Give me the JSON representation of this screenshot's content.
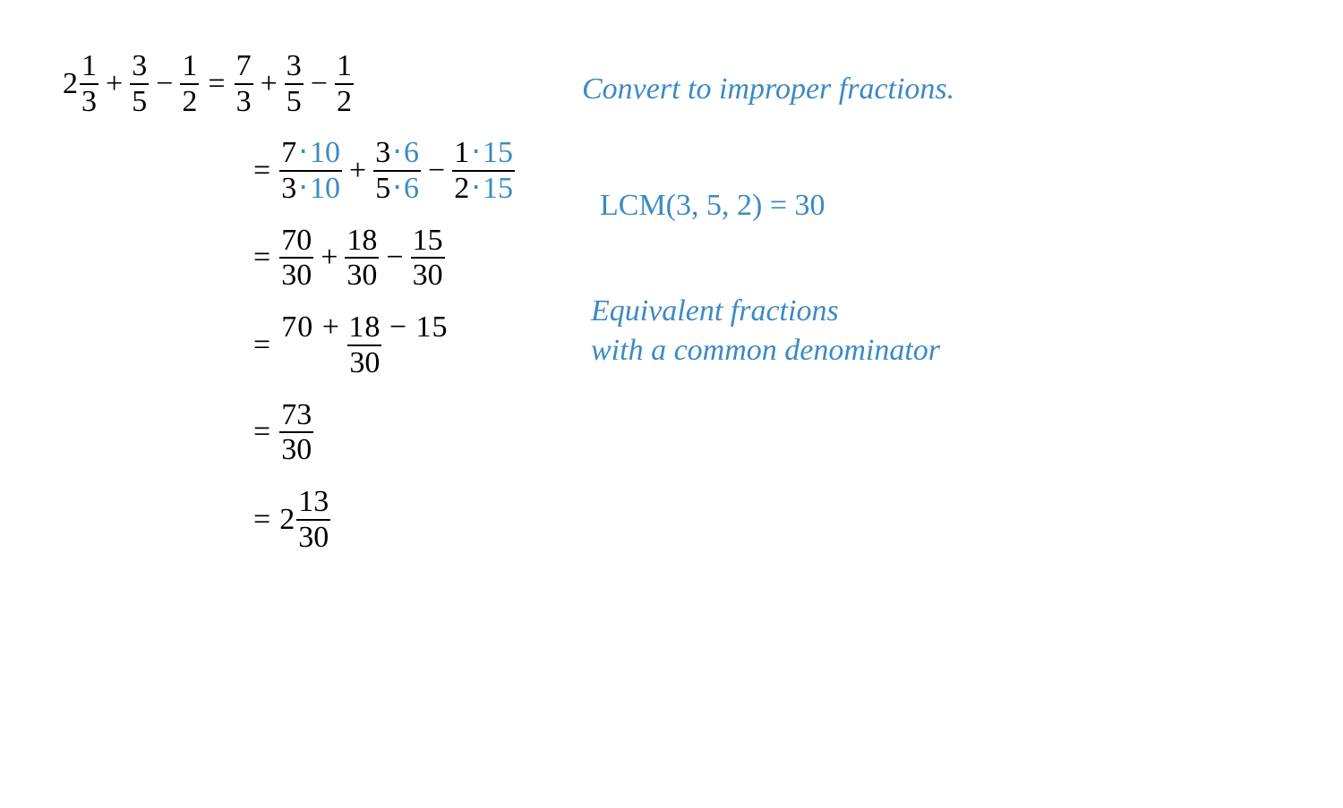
{
  "accent_color": "#3b8ac4",
  "line1": {
    "lhs": {
      "mixed": {
        "whole": "2",
        "num": "1",
        "den": "3"
      },
      "op1": "+",
      "frac2": {
        "num": "3",
        "den": "5"
      },
      "op2": "−",
      "frac3": {
        "num": "1",
        "den": "2"
      }
    },
    "eq": "=",
    "rhs": {
      "frac1": {
        "num": "7",
        "den": "3"
      },
      "op1": "+",
      "frac2": {
        "num": "3",
        "den": "5"
      },
      "op2": "−",
      "frac3": {
        "num": "1",
        "den": "2"
      }
    }
  },
  "line2": {
    "eq": "=",
    "t1": {
      "n1": "7",
      "n2": "10",
      "d1": "3",
      "d2": "10"
    },
    "op1": "+",
    "t2": {
      "n1": "3",
      "n2": "6",
      "d1": "5",
      "d2": "6"
    },
    "op2": "−",
    "t3": {
      "n1": "1",
      "n2": "15",
      "d1": "2",
      "d2": "15"
    },
    "dot": "⋅"
  },
  "line3": {
    "eq": "=",
    "f1": {
      "num": "70",
      "den": "30"
    },
    "op1": "+",
    "f2": {
      "num": "18",
      "den": "30"
    },
    "op2": "−",
    "f3": {
      "num": "15",
      "den": "30"
    }
  },
  "line4": {
    "eq": "=",
    "num": "70 + 18 − 15",
    "den": "30"
  },
  "line5": {
    "eq": "=",
    "num": "73",
    "den": "30"
  },
  "line6": {
    "eq": "=",
    "whole": "2",
    "num": "13",
    "den": "30"
  },
  "annotations": {
    "a1": "Convert to improper fractions.",
    "a2": "LCM(3,  5,  2)   =   30",
    "a3_l1": "Equivalent fractions",
    "a3_l2": "with a common denominator"
  }
}
